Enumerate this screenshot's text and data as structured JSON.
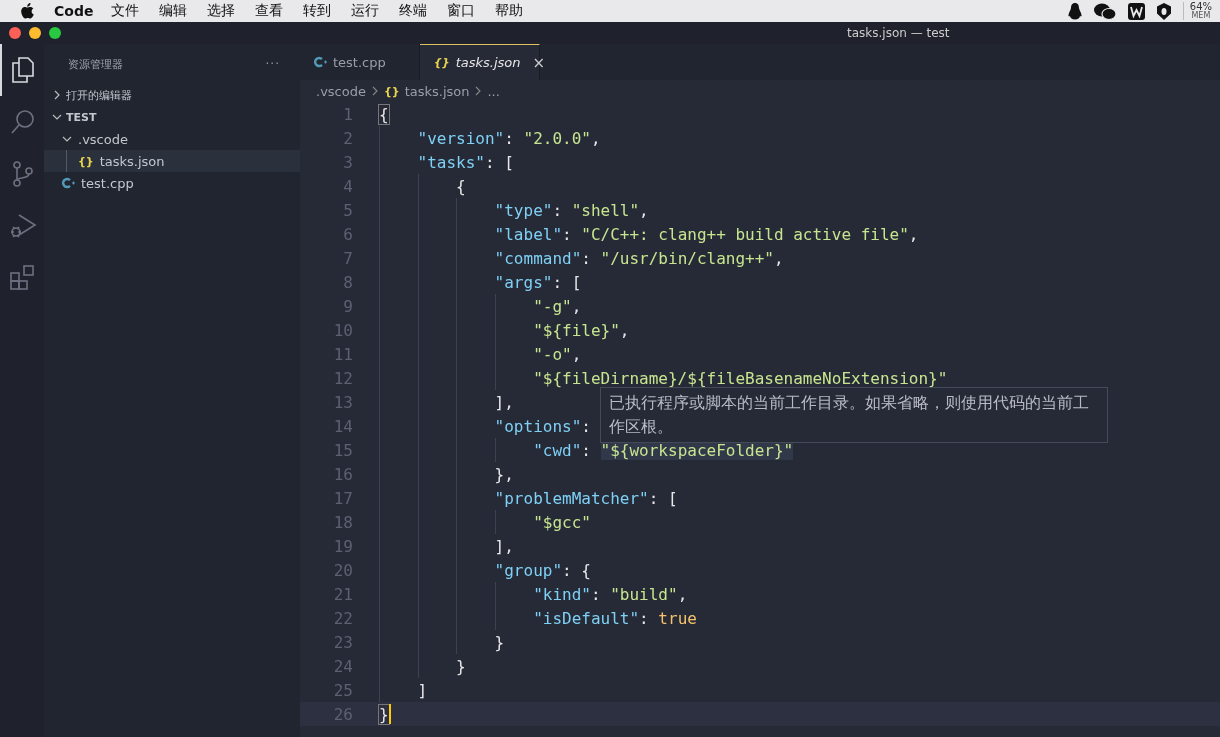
{
  "menu_bar": {
    "app": "Code",
    "items": [
      "文件",
      "编辑",
      "选择",
      "查看",
      "转到",
      "运行",
      "终端",
      "窗口",
      "帮助"
    ],
    "memory": {
      "percent": "64%",
      "label": "MEM"
    }
  },
  "window": {
    "title": "tasks.json — test"
  },
  "activity_bar": [
    {
      "kind": "files",
      "selected": true
    },
    {
      "kind": "search",
      "selected": false
    },
    {
      "kind": "branch",
      "selected": false
    },
    {
      "kind": "run",
      "selected": false
    },
    {
      "kind": "extensions",
      "selected": false
    }
  ],
  "sidebar": {
    "title": "资源管理器",
    "more": "···",
    "sections": [
      {
        "label": "打开的编辑器",
        "expanded": false
      },
      {
        "label": "TEST",
        "expanded": true
      }
    ],
    "tree": [
      {
        "name": ".vscode",
        "kind": "folder",
        "expanded": true,
        "selected": false,
        "children": [
          {
            "name": "tasks.json",
            "kind": "json",
            "icon": "{}",
            "selected": true
          }
        ]
      },
      {
        "name": "test.cpp",
        "kind": "cpp",
        "selected": false
      }
    ]
  },
  "tabs": [
    {
      "label": "test.cpp",
      "kind": "cpp",
      "selected": false
    },
    {
      "label": "tasks.json",
      "kind": "json",
      "icon": "{}",
      "selected": true,
      "close": "×"
    }
  ],
  "breadcrumb": [
    {
      "label": ".vscode",
      "kind": "folder"
    },
    {
      "label": "tasks.json",
      "kind": "json",
      "icon": "{}"
    },
    {
      "label": "...",
      "kind": "more"
    }
  ],
  "editor": {
    "lines": [
      {
        "number": "1",
        "tokens": [
          {
            "t": "{",
            "kind": "bracket"
          }
        ]
      },
      {
        "number": "2",
        "tokens": [
          {
            "t": "    \"version\"",
            "kind": "key"
          },
          {
            "t": ": ",
            "kind": "punct"
          },
          {
            "t": "\"2.0.0\"",
            "kind": "string"
          },
          {
            "t": ",",
            "kind": "punct"
          }
        ]
      },
      {
        "number": "3",
        "tokens": [
          {
            "t": "    \"tasks\"",
            "kind": "key"
          },
          {
            "t": ": [",
            "kind": "punct"
          }
        ]
      },
      {
        "number": "4",
        "tokens": [
          {
            "t": "        {",
            "kind": "punct"
          }
        ]
      },
      {
        "number": "5",
        "tokens": [
          {
            "t": "            \"type\"",
            "kind": "key"
          },
          {
            "t": ": ",
            "kind": "punct"
          },
          {
            "t": "\"shell\"",
            "kind": "string"
          },
          {
            "t": ",",
            "kind": "punct"
          }
        ]
      },
      {
        "number": "6",
        "tokens": [
          {
            "t": "            \"label\"",
            "kind": "key"
          },
          {
            "t": ": ",
            "kind": "punct"
          },
          {
            "t": "\"C/C++: clang++ build active file\"",
            "kind": "string"
          },
          {
            "t": ",",
            "kind": "punct"
          }
        ]
      },
      {
        "number": "7",
        "tokens": [
          {
            "t": "            \"command\"",
            "kind": "key"
          },
          {
            "t": ": ",
            "kind": "punct"
          },
          {
            "t": "\"/usr/bin/clang++\"",
            "kind": "string"
          },
          {
            "t": ",",
            "kind": "punct"
          }
        ]
      },
      {
        "number": "8",
        "tokens": [
          {
            "t": "            \"args\"",
            "kind": "key"
          },
          {
            "t": ": [",
            "kind": "punct"
          }
        ]
      },
      {
        "number": "9",
        "tokens": [
          {
            "t": "                \"-g\"",
            "kind": "string"
          },
          {
            "t": ",",
            "kind": "punct"
          }
        ]
      },
      {
        "number": "10",
        "tokens": [
          {
            "t": "                \"${file}\"",
            "kind": "string"
          },
          {
            "t": ",",
            "kind": "punct"
          }
        ]
      },
      {
        "number": "11",
        "tokens": [
          {
            "t": "                \"-o\"",
            "kind": "string"
          },
          {
            "t": ",",
            "kind": "punct"
          }
        ]
      },
      {
        "number": "12",
        "tokens": [
          {
            "t": "                \"${fileDirname}/${fileBasenameNoExtension}\"",
            "kind": "string"
          }
        ]
      },
      {
        "number": "13",
        "tokens": [
          {
            "t": "            ],",
            "kind": "punct"
          }
        ]
      },
      {
        "number": "14",
        "tokens": [
          {
            "t": "            \"options\"",
            "kind": "key"
          },
          {
            "t": ":",
            "kind": "punct"
          }
        ]
      },
      {
        "number": "15",
        "tokens": [
          {
            "t": "                \"cwd\"",
            "kind": "key"
          },
          {
            "t": ": ",
            "kind": "punct"
          },
          {
            "t": "\"${workspaceFolder}\"",
            "kind": "hover"
          }
        ]
      },
      {
        "number": "16",
        "tokens": [
          {
            "t": "            },",
            "kind": "punct"
          }
        ]
      },
      {
        "number": "17",
        "tokens": [
          {
            "t": "            \"problemMatcher\"",
            "kind": "key"
          },
          {
            "t": ": [",
            "kind": "punct"
          }
        ]
      },
      {
        "number": "18",
        "tokens": [
          {
            "t": "                \"$gcc\"",
            "kind": "string"
          }
        ]
      },
      {
        "number": "19",
        "tokens": [
          {
            "t": "            ],",
            "kind": "punct"
          }
        ]
      },
      {
        "number": "20",
        "tokens": [
          {
            "t": "            \"group\"",
            "kind": "key"
          },
          {
            "t": ": {",
            "kind": "punct"
          }
        ]
      },
      {
        "number": "21",
        "tokens": [
          {
            "t": "                \"kind\"",
            "kind": "key"
          },
          {
            "t": ": ",
            "kind": "punct"
          },
          {
            "t": "\"build\"",
            "kind": "string"
          },
          {
            "t": ",",
            "kind": "punct"
          }
        ]
      },
      {
        "number": "22",
        "tokens": [
          {
            "t": "                \"isDefault\"",
            "kind": "key"
          },
          {
            "t": ": ",
            "kind": "punct"
          },
          {
            "t": "true",
            "kind": "bool"
          }
        ]
      },
      {
        "number": "23",
        "tokens": [
          {
            "t": "            }",
            "kind": "punct"
          }
        ]
      },
      {
        "number": "24",
        "tokens": [
          {
            "t": "        }",
            "kind": "punct"
          }
        ]
      },
      {
        "number": "25",
        "tokens": [
          {
            "t": "    ]",
            "kind": "punct"
          }
        ]
      },
      {
        "number": "26",
        "tokens": [
          {
            "t": "}",
            "kind": "bracket"
          }
        ],
        "cursor": true
      }
    ],
    "hover": {
      "text": "已执行程序或脚本的当前工作目录。如果省略，则使用代码的当前工作区根。"
    }
  }
}
